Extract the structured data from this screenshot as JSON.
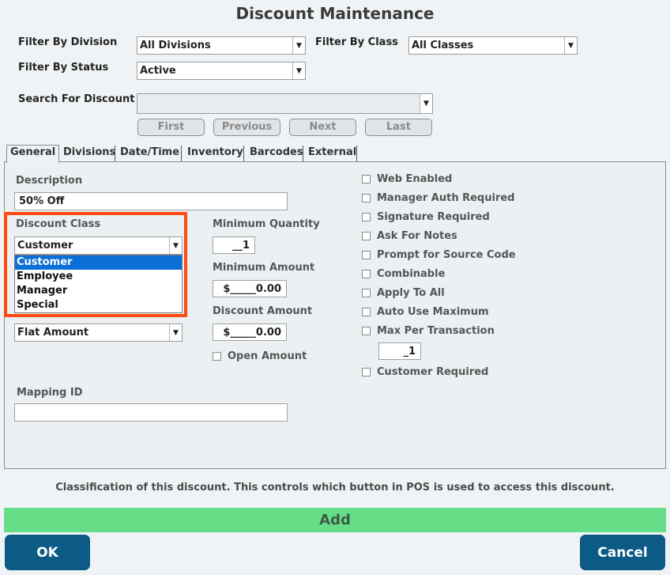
{
  "window": {
    "title": "Discount Maintenance"
  },
  "filters": {
    "division_label": "Filter By Division",
    "division_value": "All Divisions",
    "class_label": "Filter By Class",
    "class_value": "All Classes",
    "status_label": "Filter By Status",
    "status_value": "Active",
    "search_label": "Search For Discount",
    "search_value": ""
  },
  "nav": {
    "first": "First",
    "previous": "Previous",
    "next": "Next",
    "last": "Last"
  },
  "tabs": [
    {
      "label": "General"
    },
    {
      "label": "Divisions"
    },
    {
      "label": "Date/Time"
    },
    {
      "label": "Inventory"
    },
    {
      "label": "Barcodes"
    },
    {
      "label": "External"
    }
  ],
  "general": {
    "description_label": "Description",
    "description_value": "50% Off",
    "discount_class_label": "Discount Class",
    "discount_class_value": "Customer",
    "discount_class_options": [
      "Customer",
      "Employee",
      "Manager",
      "Special"
    ],
    "discount_type_value": "Flat Amount",
    "min_quantity_label": "Minimum Quantity",
    "min_quantity_value": "__1",
    "min_amount_label": "Minimum Amount",
    "min_amount_value": "$_____0.00",
    "discount_amount_label": "Discount Amount",
    "discount_amount_value": "$_____0.00",
    "open_amount_label": "Open Amount",
    "mapping_id_label": "Mapping ID",
    "mapping_id_value": "",
    "options": [
      "Web Enabled",
      "Manager Auth Required",
      "Signature Required",
      "Ask For Notes",
      "Prompt for Source Code",
      "Combinable",
      "Apply To All",
      "Auto Use Maximum",
      "Max Per Transaction"
    ],
    "max_per_transaction_value": "_1",
    "customer_required_label": "Customer Required"
  },
  "status_text": "Classification of this discount.  This controls which button in POS is used to access this discount.",
  "actions": {
    "add": "Add",
    "ok": "OK",
    "cancel": "Cancel"
  },
  "colors": {
    "highlight": "#ff4a12",
    "add_bar": "#66de88",
    "primary_button": "#0c5a86",
    "selection": "#0a6fd6"
  }
}
